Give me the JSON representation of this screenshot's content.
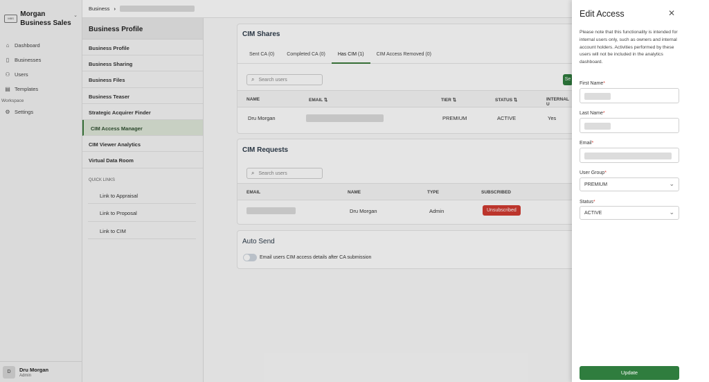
{
  "brand": {
    "name": "Morgan Business Sales",
    "logo_text": "MBS"
  },
  "nav": {
    "items": [
      {
        "label": "Dashboard",
        "icon": "home-icon"
      },
      {
        "label": "Businesses",
        "icon": "document-icon"
      },
      {
        "label": "Users",
        "icon": "users-icon"
      },
      {
        "label": "Templates",
        "icon": "template-icon"
      }
    ],
    "workspace_label": "Workspace",
    "settings_label": "Settings"
  },
  "user": {
    "initial": "D",
    "name": "Dru Morgan",
    "role": "Admin"
  },
  "breadcrumb": {
    "root": "Business"
  },
  "profile_nav": {
    "title": "Business Profile",
    "items": [
      "Business Profile",
      "Business Sharing",
      "Business Files",
      "Business Teaser",
      "Strategic Acquirer Finder",
      "CIM Access Manager",
      "CIM Viewer Analytics",
      "Virtual Data Room"
    ],
    "active_index": 5,
    "quick_links_title": "QUICK LINKS",
    "quick_links": [
      "Link to Appraisal",
      "Link to Proposal",
      "Link to CIM"
    ]
  },
  "cim_shares": {
    "title": "CIM Shares",
    "tabs": [
      "Sent CA (0)",
      "Completed CA (0)",
      "Has CIM (1)",
      "CIM Access Removed (0)"
    ],
    "active_tab": 2,
    "search_placeholder": "Search users",
    "button_partial": "Se",
    "columns": [
      "NAME",
      "EMAIL",
      "TIER",
      "STATUS",
      "INTERNAL U"
    ],
    "sort_icon": "sort-icon",
    "rows": [
      {
        "name": "Dru Morgan",
        "tier": "PREMIUM",
        "status": "ACTIVE",
        "internal": "Yes"
      }
    ]
  },
  "cim_requests": {
    "title": "CIM Requests",
    "search_placeholder": "Search users",
    "columns": [
      "EMAIL",
      "NAME",
      "TYPE",
      "SUBSCRIBED"
    ],
    "rows": [
      {
        "name": "Dru Morgan",
        "type": "Admin",
        "subscribed": "Unsubscribed"
      }
    ]
  },
  "auto_send": {
    "title": "Auto Send",
    "toggle_label": "Email users CIM access details after CA submission",
    "enabled": false
  },
  "edit_access": {
    "title": "Edit Access",
    "note": "Please note that this functionality is intended for internal users only, such as owners and internal account holders. Activities performed by these users will not be included in the analytics dashboard.",
    "first_name_label": "First Name",
    "last_name_label": "Last Name",
    "email_label": "Email",
    "user_group_label": "User Group",
    "user_group_value": "PREMIUM",
    "status_label": "Status",
    "status_value": "ACTIVE",
    "required_mark": "*",
    "update_label": "Update"
  },
  "colors": {
    "accent": "#2f7d3e",
    "danger": "#d23b32"
  }
}
